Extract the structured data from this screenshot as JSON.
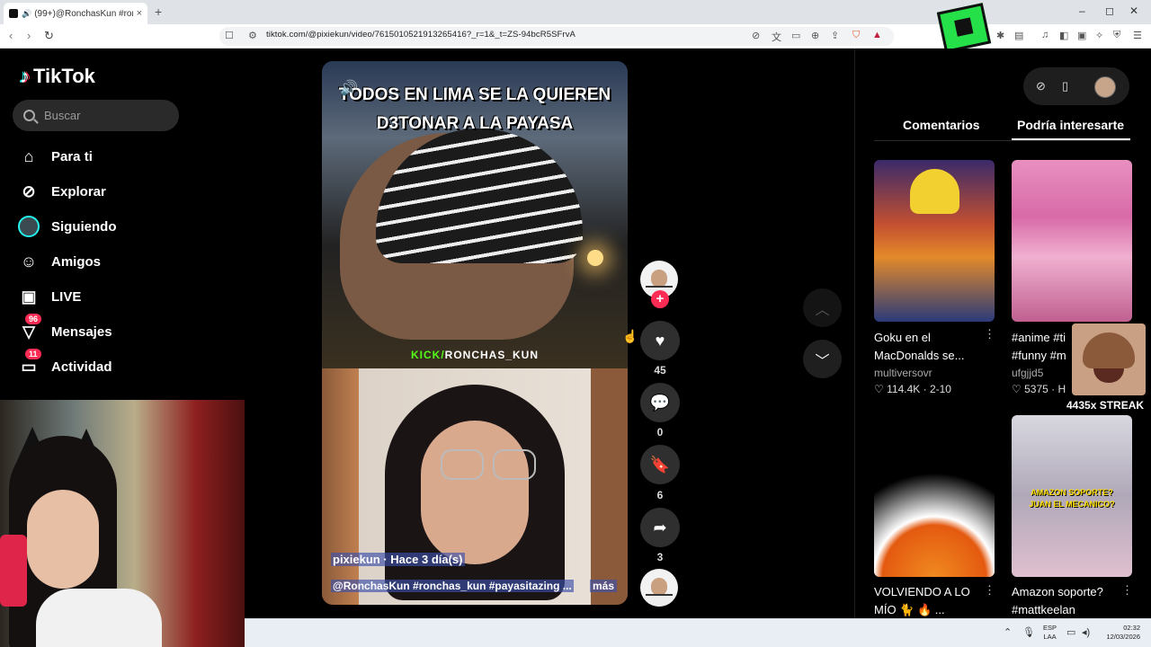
{
  "browser": {
    "tab_title": "(99+)@RonchasKun #roncha",
    "tab_close": "×",
    "new_tab": "+",
    "url": "tiktok.com/@pixiekun/video/7615010521913265416?_r=1&_t=ZS-94bcR5SFrvA",
    "window_controls": [
      "–",
      "◻",
      "✕"
    ]
  },
  "sidebar": {
    "logo": "TikTok",
    "search_placeholder": "Buscar",
    "items": [
      {
        "label": "Para ti",
        "icon": "home-icon",
        "badge": ""
      },
      {
        "label": "Explorar",
        "icon": "compass-icon",
        "badge": ""
      },
      {
        "label": "Siguiendo",
        "icon": "following-avatar-icon",
        "badge": ""
      },
      {
        "label": "Amigos",
        "icon": "friends-icon",
        "badge": ""
      },
      {
        "label": "LIVE",
        "icon": "live-tv-icon",
        "badge": ""
      },
      {
        "label": "Mensajes",
        "icon": "send-icon",
        "badge": "96"
      },
      {
        "label": "Actividad",
        "icon": "inbox-icon",
        "badge": "11"
      }
    ]
  },
  "video": {
    "caption_line1": "TODOS EN LIMA SE LA QUIEREN",
    "caption_line2": "D3TONAR A LA PAYASA",
    "kick_prefix": "KICK/",
    "kick_channel": "RONCHAS_KUN",
    "author_line": "pixiekun · Hace 3 día(s)",
    "description": "@RonchasKun #ronchas_kun #payasitazing ...",
    "more": "más"
  },
  "actions": {
    "follow": "+",
    "likes": "45",
    "comments": "0",
    "saves": "6",
    "shares": "3"
  },
  "right_panel": {
    "tabs": [
      "Comentarios",
      "Podría interesarte"
    ],
    "active_tab": "Podría interesarte",
    "cards": [
      {
        "title": "Goku en el MacDonalds se...",
        "user": "multiversovr",
        "likes": "114.4K",
        "date": "2-10"
      },
      {
        "title": "#anime #ti #funny #m",
        "user": "ufgjjd5",
        "likes": "5375",
        "date": "H"
      },
      {
        "title": "VOLVIENDO A LO MÍO 🐈 🔥 ...",
        "user": "",
        "likes": "",
        "date": ""
      },
      {
        "title": "Amazon soporte? #mattkeelan",
        "user": "",
        "likes": "",
        "date": "",
        "thumb_caption": "AMAZON SOPORTE? JUAN EL MECANICO?"
      }
    ]
  },
  "overlay": {
    "streak": "4435x STREAK"
  },
  "taskbar": {
    "lang_line1": "ESP",
    "lang_line2": "LAA",
    "time": "02:32",
    "date": "12/03/2026"
  },
  "colors": {
    "accent": "#fe2c55",
    "kick_green": "#53fc18",
    "background": "#000000"
  }
}
